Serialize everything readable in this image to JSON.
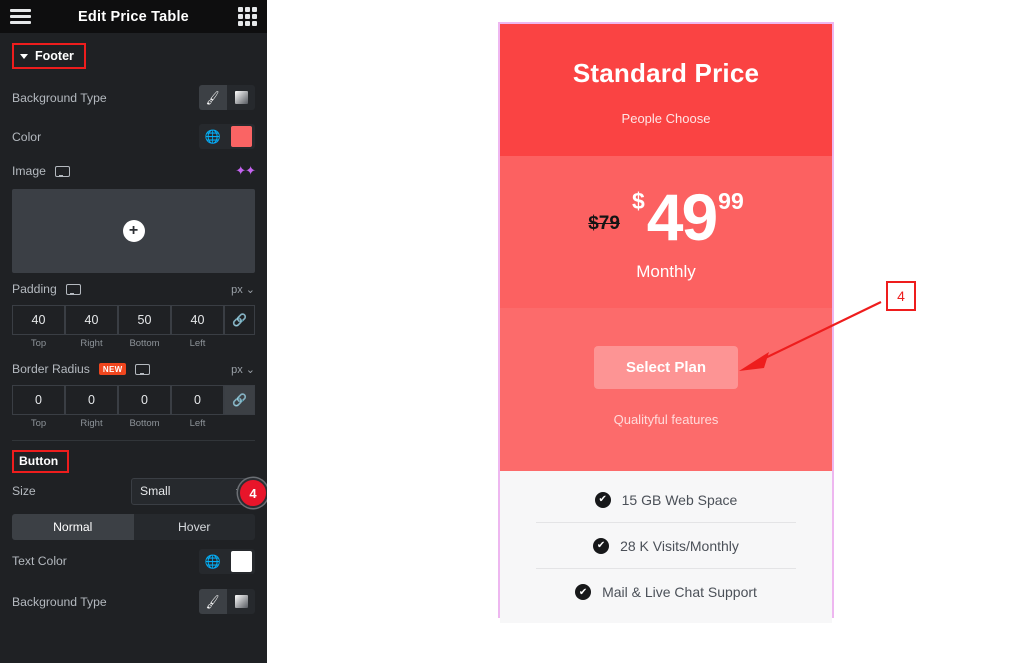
{
  "panel": {
    "title": "Edit Price Table",
    "menu_icon": "hamburger-icon",
    "apps_icon": "grid-apps-icon",
    "section": {
      "label": "Footer",
      "expanded": true
    },
    "controls": {
      "background_type": {
        "label": "Background Type",
        "options": [
          "Classic",
          "Gradient"
        ],
        "selected": "Classic"
      },
      "color": {
        "label": "Color",
        "value": "#fa6464",
        "global_icon": "globe-icon"
      },
      "image": {
        "label": "Image",
        "device_icon": "desktop-icon",
        "ai_icon": "ai-sparkle-icon",
        "add_icon": "plus-icon"
      },
      "padding": {
        "label": "Padding",
        "unit": "px",
        "device_icon": "desktop-icon",
        "values": [
          "40",
          "40",
          "50",
          "40"
        ],
        "sides": [
          "Top",
          "Right",
          "Bottom",
          "Left"
        ],
        "linked": false
      },
      "border_radius": {
        "label": "Border Radius",
        "badge": "NEW",
        "unit": "px",
        "device_icon": "desktop-icon",
        "values": [
          "0",
          "0",
          "0",
          "0"
        ],
        "sides": [
          "Top",
          "Right",
          "Bottom",
          "Left"
        ],
        "linked": true
      }
    },
    "button_section": {
      "label": "Button",
      "size": {
        "label": "Size",
        "value": "Small"
      },
      "state_tabs": [
        {
          "label": "Normal",
          "active": true
        },
        {
          "label": "Hover",
          "active": false
        }
      ],
      "text_color": {
        "label": "Text Color",
        "value": "#ffffff",
        "global_icon": "globe-icon"
      },
      "background_type": {
        "label": "Background Type",
        "options": [
          "Classic",
          "Gradient"
        ],
        "selected": "Classic"
      }
    },
    "collapse_handle_icon": "chevron-left-icon",
    "badge": "4"
  },
  "price_table": {
    "title": "Standard Price",
    "subtitle": "People Choose",
    "price": {
      "original": "$79",
      "currency": "$",
      "integer": "49",
      "fraction": "99",
      "period": "Monthly"
    },
    "cta": "Select Plan",
    "footer_note": "Qualityful features",
    "features": [
      {
        "icon": "check-circle-icon",
        "label": "15 GB Web Space"
      },
      {
        "icon": "check-circle-icon",
        "label": "28 K Visits/Monthly"
      },
      {
        "icon": "check-circle-icon",
        "label": "Mail & Live Chat Support"
      }
    ],
    "colors": {
      "header_bg": "#fa4343",
      "price_bg": "#fc6161",
      "footer_bg": "#fc6b6b",
      "button_bg": "#fd9494",
      "features_bg": "#f7f7f8",
      "selection_border": "#eeb7f0"
    }
  },
  "annotation": {
    "marker": "4",
    "color": "#ee1d1d"
  }
}
